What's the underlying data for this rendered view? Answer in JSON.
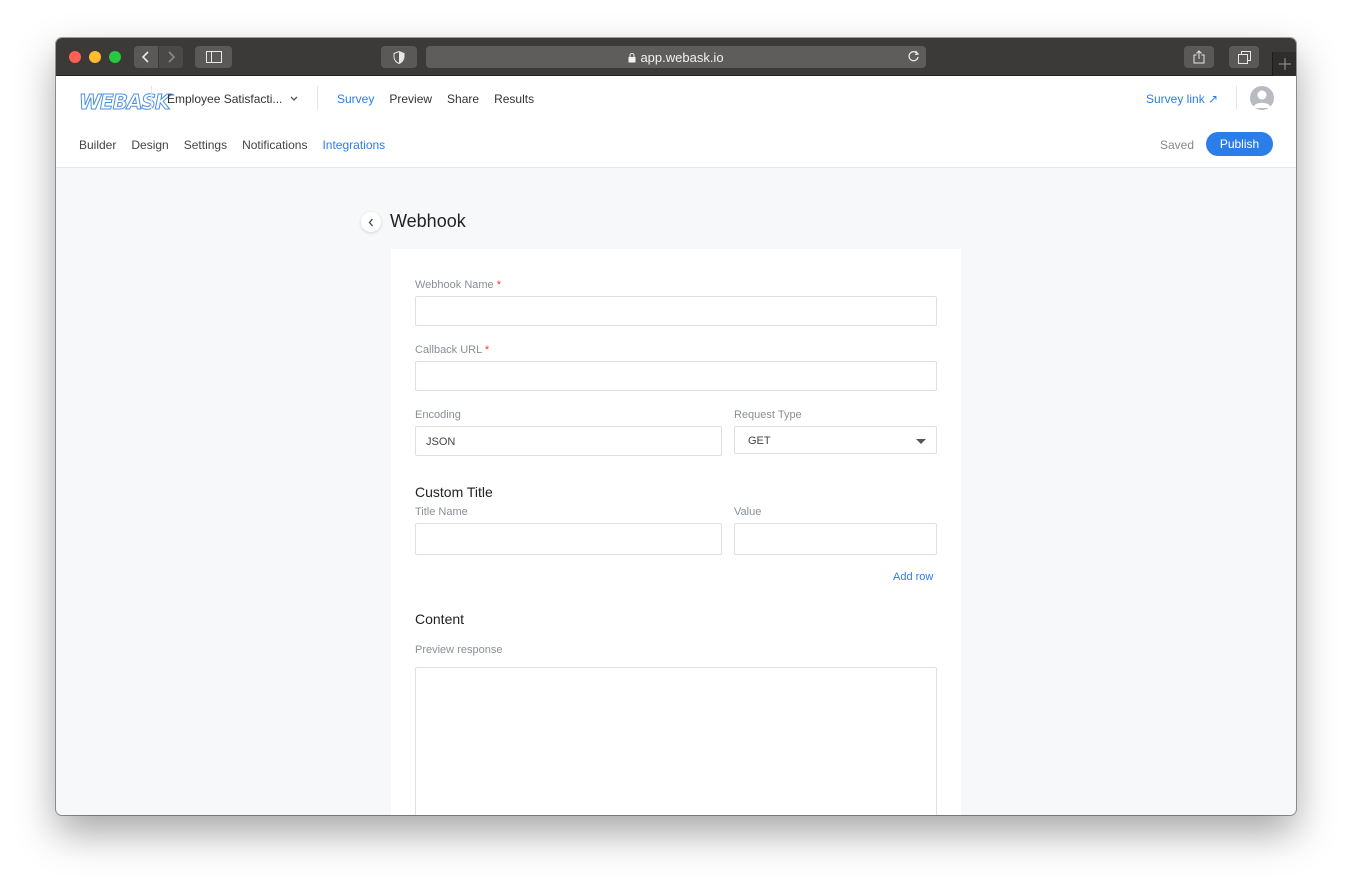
{
  "browser": {
    "url": "app.webask.io"
  },
  "header": {
    "logo": "WEBASK",
    "survey_title": "Employee Satisfacti...",
    "nav": [
      {
        "label": "Survey",
        "active": true
      },
      {
        "label": "Preview",
        "active": false
      },
      {
        "label": "Share",
        "active": false
      },
      {
        "label": "Results",
        "active": false
      }
    ],
    "survey_link": "Survey link ↗",
    "subnav": [
      {
        "label": "Builder",
        "active": false
      },
      {
        "label": "Design",
        "active": false
      },
      {
        "label": "Settings",
        "active": false
      },
      {
        "label": "Notifications",
        "active": false
      },
      {
        "label": "Integrations",
        "active": true
      }
    ],
    "status": "Saved",
    "publish_label": "Publish"
  },
  "page": {
    "title": "Webhook"
  },
  "form": {
    "webhook_name_label": "Webhook Name",
    "webhook_name_value": "",
    "callback_url_label": "Callback URL",
    "callback_url_value": "",
    "required_mark": "*",
    "encoding_label": "Encoding",
    "encoding_value": "JSON",
    "request_type_label": "Request Type",
    "request_type_value": "GET",
    "custom_title_heading": "Custom Title",
    "title_name_label": "Title Name",
    "title_name_value": "",
    "value_label": "Value",
    "value_value": "",
    "add_row_label": "Add row",
    "content_heading": "Content",
    "preview_response_label": "Preview response",
    "preview_response_value": ""
  },
  "colors": {
    "accent": "#2b7de9",
    "required": "#e53935"
  }
}
